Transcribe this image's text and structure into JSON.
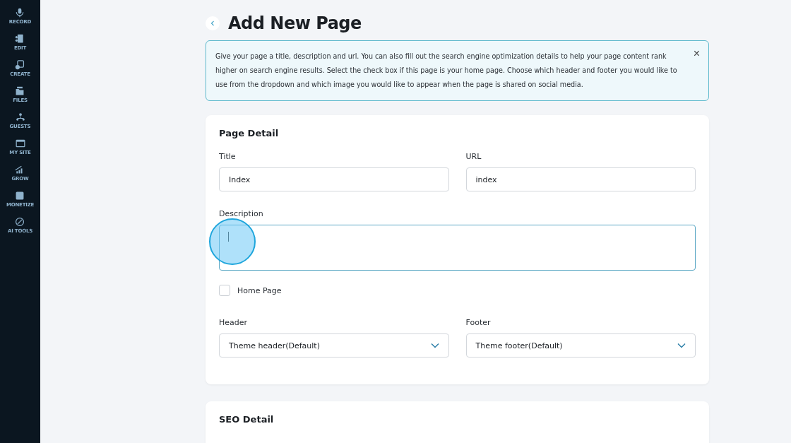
{
  "sidebar": {
    "items": [
      {
        "label": "RECORD"
      },
      {
        "label": "EDIT"
      },
      {
        "label": "CREATE"
      },
      {
        "label": "FILES"
      },
      {
        "label": "GUESTS"
      },
      {
        "label": "MY SITE"
      },
      {
        "label": "GROW"
      },
      {
        "label": "MONETIZE"
      },
      {
        "label": "AI TOOLS"
      }
    ]
  },
  "page": {
    "title": "Add New Page"
  },
  "banner": {
    "text": "Give your page a title, description and url. You can also fill out the search engine optimization details to help your page content rank higher on search engine results. Select the check box if this page is your home page. Choose which header and footer you would like to use from the dropdown and which image you would like to appear when the page is shared on social media.",
    "close": "×"
  },
  "page_detail": {
    "heading": "Page Detail",
    "title_field": {
      "label": "Title",
      "value": "Index"
    },
    "url_field": {
      "label": "URL",
      "value": "index"
    },
    "description_field": {
      "label": "Description"
    },
    "home_page": {
      "label": "Home Page",
      "checked": false
    },
    "header_select": {
      "label": "Header",
      "value": "Theme header(Default)"
    },
    "footer_select": {
      "label": "Footer",
      "value": "Theme footer(Default)"
    }
  },
  "seo_detail": {
    "heading": "SEO Detail"
  }
}
